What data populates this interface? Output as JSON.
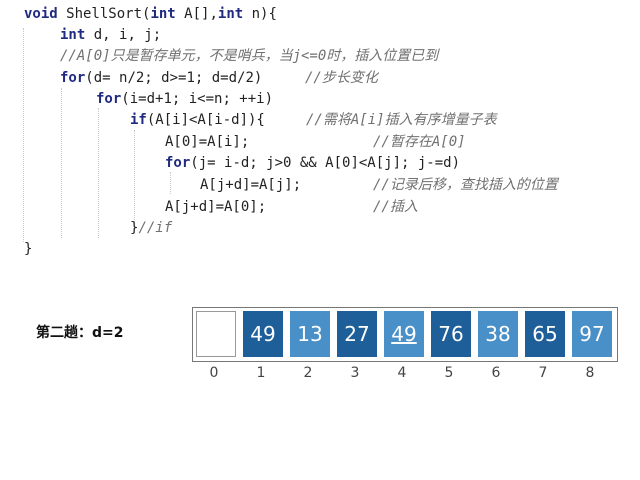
{
  "code": {
    "line1": {
      "kw1": "void",
      "rest": " ShellSort(",
      "kw2": "int",
      "mid": " A[],",
      "kw3": "int",
      "end": " n){"
    },
    "line2": {
      "kw": "int",
      "rest": " d, i, j;"
    },
    "line3": {
      "comment": "//A[0]只是暂存单元，不是哨兵，当j<=0时，插入位置已到"
    },
    "line4": {
      "kw": "for",
      "code": "(d= n/2; d>=1; d=d/2)",
      "comment": "//步长变化"
    },
    "line5": {
      "kw": "for",
      "code": "(i=d+1; i<=n; ++i)"
    },
    "line6": {
      "kw": "if",
      "code": "(A[i]<A[i-d]){",
      "comment": "//需将A[i]插入有序增量子表"
    },
    "line7": {
      "code": "A[0]=A[i];",
      "comment": "//暂存在A[0]"
    },
    "line8": {
      "kw": "for",
      "code": "(j= i-d; j>0 && A[0]<A[j]; j-=d)"
    },
    "line9": {
      "code": "A[j+d]=A[j];",
      "comment": "//记录后移，查找插入的位置"
    },
    "line10": {
      "code": "A[j+d]=A[0];",
      "comment": "//插入"
    },
    "line11": {
      "code": "}",
      "comment": "//if"
    },
    "line12": {
      "code": "}"
    }
  },
  "stage_label": "第二趟：d=2",
  "array": {
    "cells": [
      {
        "value": "",
        "style": "empty",
        "underlined": false
      },
      {
        "value": "49",
        "style": "dark",
        "underlined": false
      },
      {
        "value": "13",
        "style": "light",
        "underlined": false
      },
      {
        "value": "27",
        "style": "dark",
        "underlined": false
      },
      {
        "value": "49",
        "style": "light",
        "underlined": true
      },
      {
        "value": "76",
        "style": "dark",
        "underlined": false
      },
      {
        "value": "38",
        "style": "light",
        "underlined": false
      },
      {
        "value": "65",
        "style": "dark",
        "underlined": false
      },
      {
        "value": "97",
        "style": "light",
        "underlined": false
      }
    ],
    "indices": [
      "0",
      "1",
      "2",
      "3",
      "4",
      "5",
      "6",
      "7",
      "8"
    ]
  },
  "colors": {
    "dark_cell": "#1e5f99",
    "light_cell": "#4a90c8",
    "keyword": "#1f2a80",
    "comment": "#707070"
  }
}
